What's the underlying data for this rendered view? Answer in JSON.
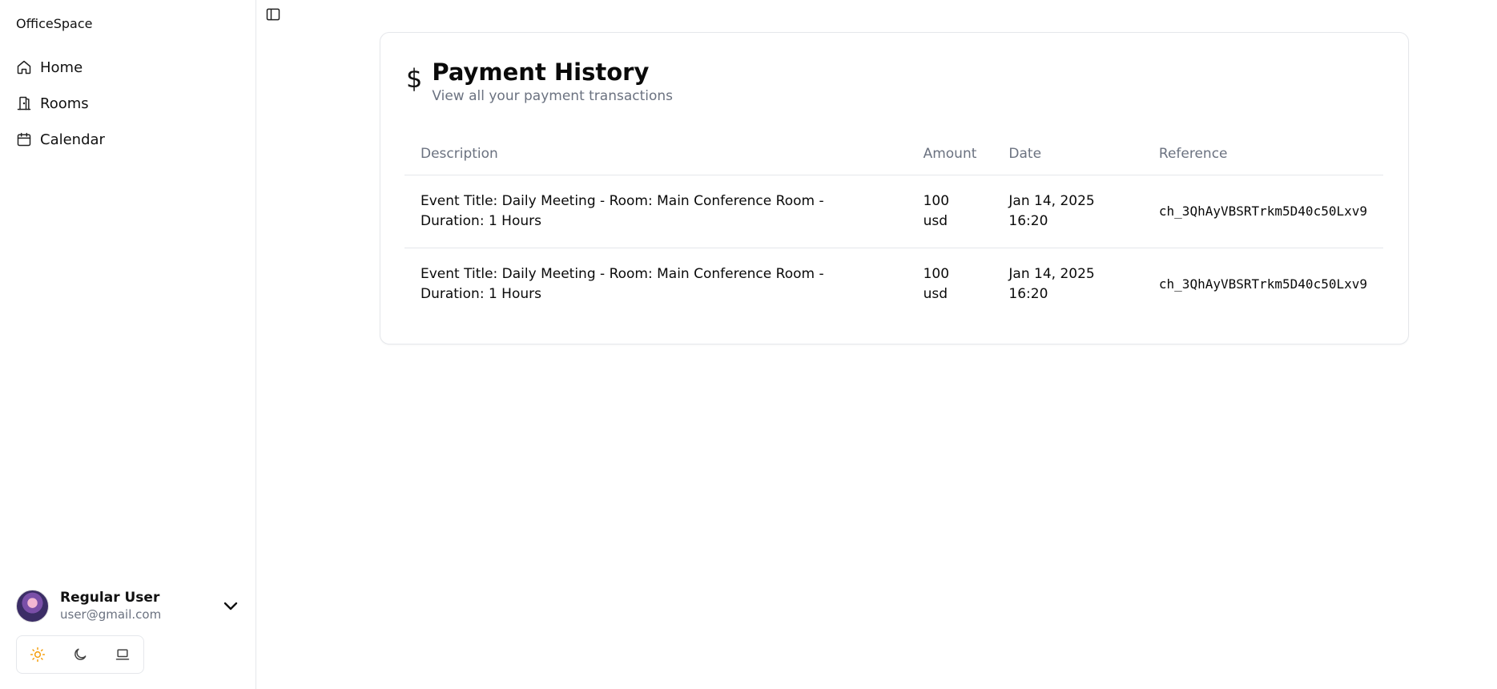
{
  "app": {
    "brand": "OfficeSpace"
  },
  "sidebar": {
    "items": [
      {
        "label": "Home",
        "icon": "home-icon"
      },
      {
        "label": "Rooms",
        "icon": "door-icon"
      },
      {
        "label": "Calendar",
        "icon": "calendar-icon"
      }
    ],
    "user": {
      "name": "Regular User",
      "email": "user@gmail.com"
    },
    "theme": {
      "options": [
        "light",
        "dark",
        "system"
      ],
      "selected": "light",
      "accent": "#f59e0b"
    }
  },
  "payments": {
    "title": "Payment History",
    "subtitle": "View all your payment transactions",
    "icon": "dollar-icon",
    "columns": [
      "Description",
      "Amount",
      "Date",
      "Reference"
    ],
    "rows": [
      {
        "description": "Event Title: Daily Meeting - Room: Main Conference Room - Duration: 1 Hours",
        "amount_value": "100",
        "amount_currency": "usd",
        "date_day": "Jan 14, 2025",
        "date_time": "16:20",
        "reference": "ch_3QhAyVBSRTrkm5D40c50Lxv9"
      },
      {
        "description": "Event Title: Daily Meeting - Room: Main Conference Room - Duration: 1 Hours",
        "amount_value": "100",
        "amount_currency": "usd",
        "date_day": "Jan 14, 2025",
        "date_time": "16:20",
        "reference": "ch_3QhAyVBSRTrkm5D40c50Lxv9"
      }
    ]
  }
}
